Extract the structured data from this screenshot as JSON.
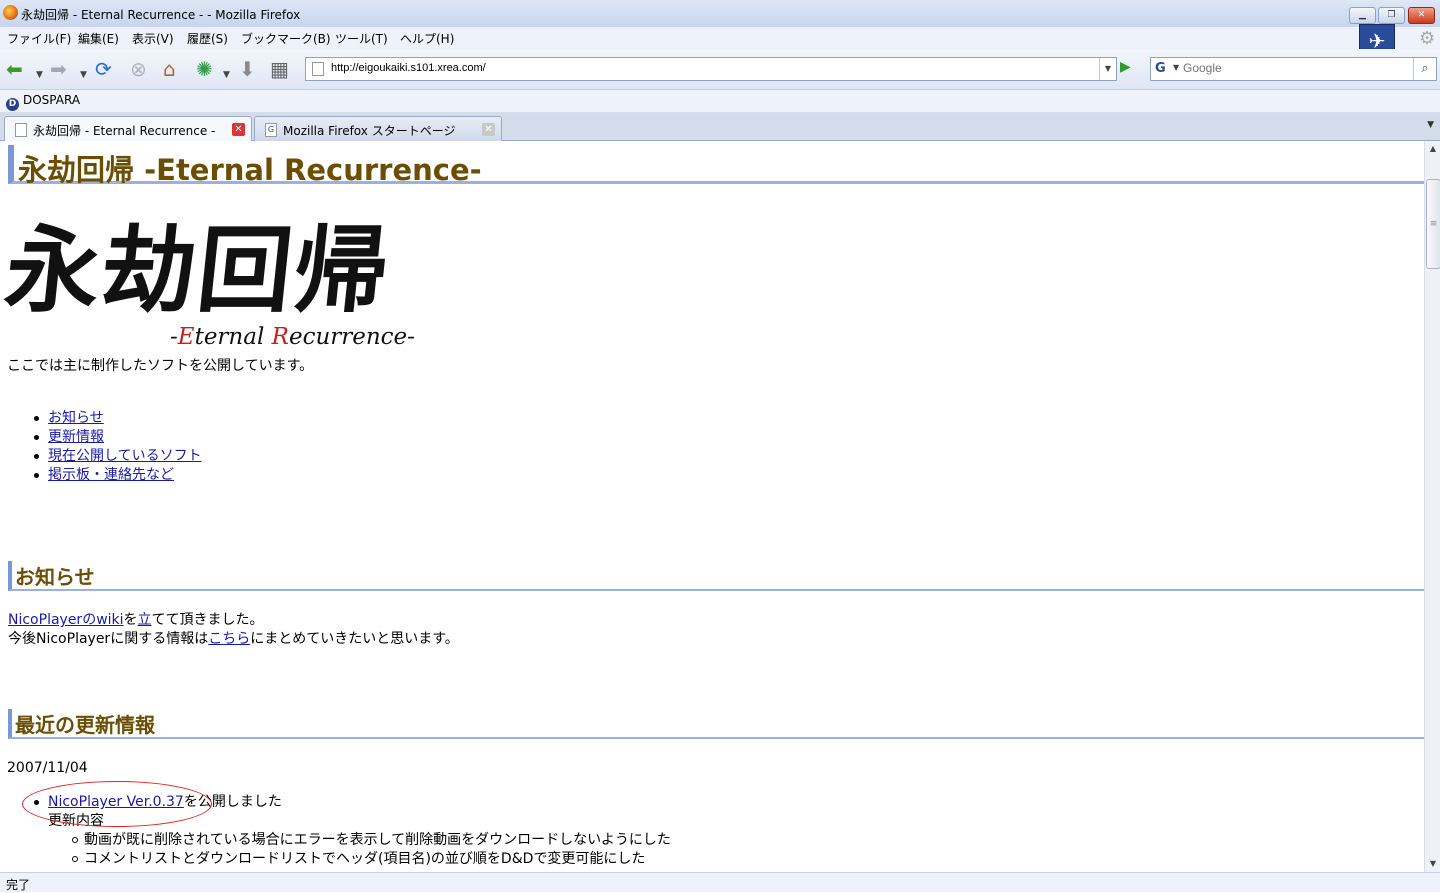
{
  "window": {
    "title": "永劫回帰 - Eternal Recurrence - - Mozilla Firefox"
  },
  "menu": [
    "ファイル(F)",
    "編集(E)",
    "表示(V)",
    "履歴(S)",
    "ブックマーク(B)",
    "ツール(T)",
    "ヘルプ(H)"
  ],
  "navigation": {
    "url": "http://eigoukaiki.s101.xrea.com/",
    "search_placeholder": "Google"
  },
  "bookmarks": [
    "DOSPARA"
  ],
  "tabs": [
    {
      "label": "永劫回帰 - Eternal Recurrence -"
    },
    {
      "label": "Mozilla Firefox スタートページ"
    }
  ],
  "page": {
    "site_title": "永劫回帰 -Eternal Recurrence-",
    "logo": {
      "kanji": "永劫回帰",
      "sub_prefix": "-",
      "sub_e": "E",
      "sub_ternal": "ternal ",
      "sub_r": "R",
      "sub_ecurrence": "ecurrence-"
    },
    "intro": "ここでは主に制作したソフトを公開しています。",
    "links": [
      "お知らせ",
      "更新情報",
      "現在公開しているソフト",
      "掲示板・連絡先など"
    ],
    "news": {
      "heading": "お知らせ",
      "line1_link1": "NicoPlayerのwiki",
      "line1_mid": "を",
      "line1_link2": "立",
      "line1_end": "てて頂きました。",
      "line2_start": "今後NicoPlayerに関する情報は",
      "line2_link": "こちら",
      "line2_end": "にまとめていきたいと思います。"
    },
    "updates": {
      "heading": "最近の更新情報",
      "date": "2007/11/04",
      "item_link": "NicoPlayer Ver.0.37",
      "item_text": "を公開しました",
      "changes_label": "更新内容",
      "changes": [
        "動画が既に削除されている場合にエラーを表示して削除動画をダウンロードしないようにした",
        "コメントリストとダウンロードリストでヘッダ(項目名)の並び順をD&Dで変更可能にした"
      ]
    }
  },
  "status": "完了"
}
